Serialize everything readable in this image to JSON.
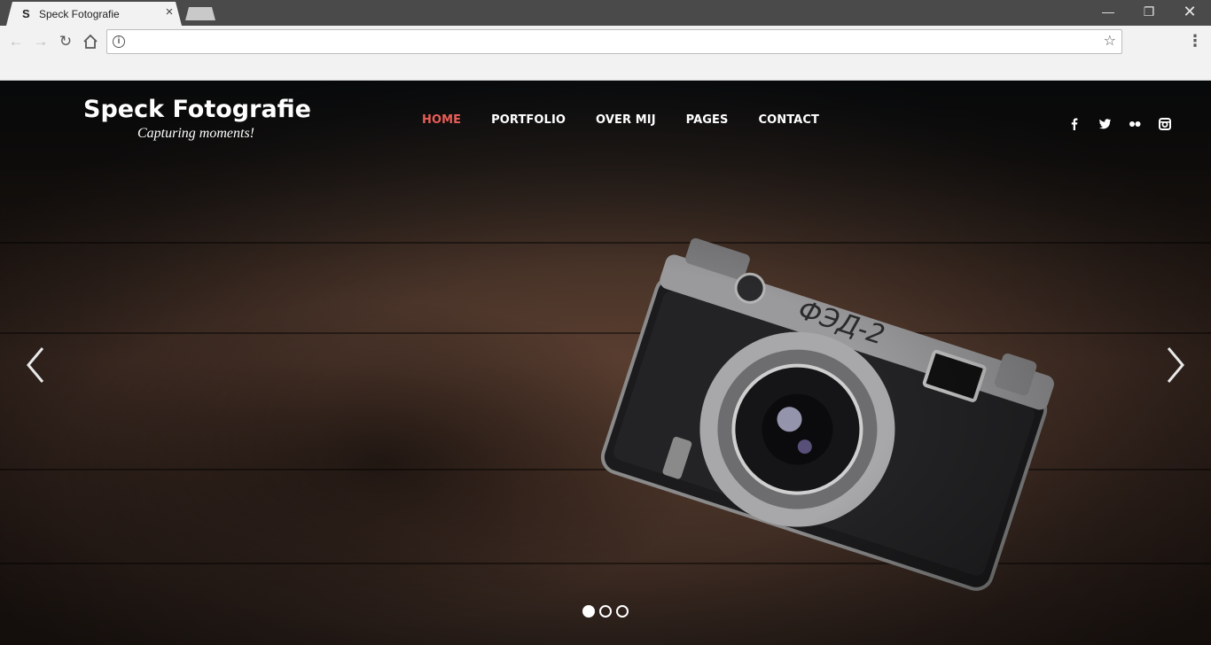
{
  "browser": {
    "tab_favicon": "S",
    "tab_title": "Speck Fotografie",
    "tab_close": "×",
    "url": "",
    "icons": [
      "back-icon",
      "forward-icon",
      "reload-icon",
      "home-icon",
      "info-icon",
      "star-icon",
      "menu-icon"
    ]
  },
  "site": {
    "title": "Speck Fotografie",
    "tagline": "Capturing moments!",
    "nav": [
      {
        "label": "HOME",
        "active": true
      },
      {
        "label": "PORTFOLIO",
        "active": false
      },
      {
        "label": "OVER MIJ",
        "active": false
      },
      {
        "label": "PAGES",
        "active": false
      },
      {
        "label": "CONTACT",
        "active": false
      }
    ],
    "social": [
      "facebook-icon",
      "twitter-icon",
      "flickr-icon",
      "instagram-icon"
    ],
    "accent_color": "#e95d57"
  },
  "slider": {
    "slide_count": 3,
    "active_slide": 1
  }
}
